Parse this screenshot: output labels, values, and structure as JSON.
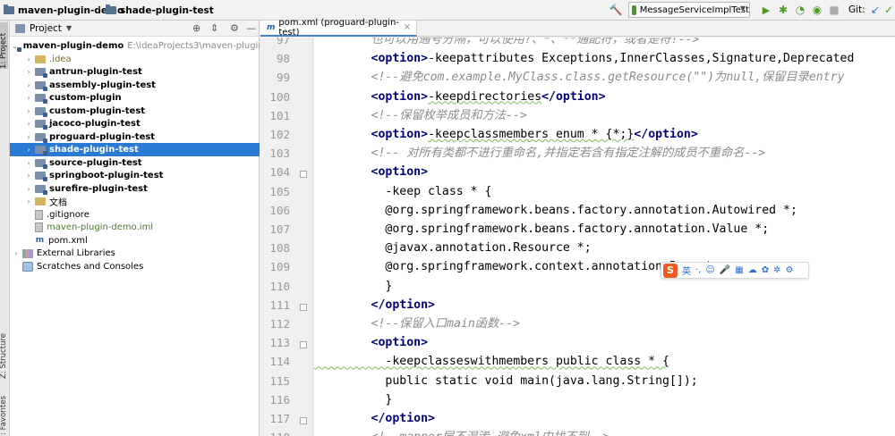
{
  "topbar": {
    "breadcrumb_root": "maven-plugin-demo",
    "breadcrumb_child": "shade-plugin-test",
    "run_config": "MessageServiceImplTest",
    "git_label": "Git:"
  },
  "sidebar_tabs": {
    "project": "1: Project",
    "structure": "Z: Structure",
    "favorites": "2: Favorites"
  },
  "project_panel": {
    "title": "Project",
    "tree": [
      {
        "label": "maven-plugin-demo",
        "path": "E:\\ideaProjects3\\maven-plugin-demo",
        "kind": "module-root",
        "expanded": true
      },
      {
        "label": ".idea",
        "kind": "folder-plain",
        "expanded": false
      },
      {
        "label": "antrun-plugin-test",
        "kind": "module",
        "expanded": false
      },
      {
        "label": "assembly-plugin-test",
        "kind": "module",
        "expanded": false
      },
      {
        "label": "custom-plugin",
        "kind": "module",
        "expanded": false
      },
      {
        "label": "custom-plugin-test",
        "kind": "module",
        "expanded": false
      },
      {
        "label": "jacoco-plugin-test",
        "kind": "module",
        "expanded": false
      },
      {
        "label": "proguard-plugin-test",
        "kind": "module",
        "expanded": false
      },
      {
        "label": "shade-plugin-test",
        "kind": "module",
        "expanded": false,
        "selected": true
      },
      {
        "label": "source-plugin-test",
        "kind": "module",
        "expanded": false
      },
      {
        "label": "springboot-plugin-test",
        "kind": "module",
        "expanded": false
      },
      {
        "label": "surefire-plugin-test",
        "kind": "module",
        "expanded": false
      },
      {
        "label": "文档",
        "kind": "folder-plain",
        "expanded": false
      },
      {
        "label": ".gitignore",
        "kind": "file"
      },
      {
        "label": "maven-plugin-demo.iml",
        "kind": "file-iml"
      },
      {
        "label": "pom.xml",
        "kind": "file-pom"
      },
      {
        "label": "External Libraries",
        "kind": "libraries",
        "expanded": false
      },
      {
        "label": "Scratches and Consoles",
        "kind": "scratches"
      }
    ]
  },
  "editor": {
    "tab_label": "pom.xml (proguard-plugin-test)",
    "lines": [
      {
        "n": "97",
        "partial": true,
        "segments": [
          {
            "t": "        也可以用通号分隔，可以使用?、*、**通配符，或者是符!-->",
            "c": "cmt"
          }
        ]
      },
      {
        "n": "98",
        "segments": [
          {
            "t": "        ",
            "c": "txt"
          },
          {
            "t": "<option>",
            "c": "tag"
          },
          {
            "t": "-keepattributes Exceptions,InnerClasses,Signature,Deprecated",
            "c": "txt"
          }
        ]
      },
      {
        "n": "99",
        "segments": [
          {
            "t": "        ",
            "c": "txt"
          },
          {
            "t": "<!--避免com.example.MyClass.class.getResource(\"\")为null,保留目录entry",
            "c": "cmt"
          }
        ]
      },
      {
        "n": "100",
        "segments": [
          {
            "t": "        ",
            "c": "txt"
          },
          {
            "t": "<option>",
            "c": "tag"
          },
          {
            "t": "-keepdirectories",
            "c": "txt"
          },
          {
            "t": "</option>",
            "c": "tag"
          }
        ]
      },
      {
        "n": "101",
        "segments": [
          {
            "t": "        ",
            "c": "txt"
          },
          {
            "t": "<!--保留枚举成员和方法-->",
            "c": "cmt"
          }
        ]
      },
      {
        "n": "102",
        "segments": [
          {
            "t": "        ",
            "c": "txt"
          },
          {
            "t": "<option>",
            "c": "tag"
          },
          {
            "t": "-keepclassmembers enum * {*;}",
            "c": "txt"
          },
          {
            "t": "</option>",
            "c": "tag"
          }
        ]
      },
      {
        "n": "103",
        "segments": [
          {
            "t": "        ",
            "c": "txt"
          },
          {
            "t": "<!-- 对所有类都不进行重命名,并指定若含有指定注解的成员不重命名-->",
            "c": "cmt"
          }
        ]
      },
      {
        "n": "104",
        "segments": [
          {
            "t": "        ",
            "c": "txt"
          },
          {
            "t": "<option>",
            "c": "tag"
          }
        ]
      },
      {
        "n": "105",
        "segments": [
          {
            "t": "          -keep class * {",
            "c": "txt"
          }
        ]
      },
      {
        "n": "106",
        "segments": [
          {
            "t": "          @org.springframework.beans.factory.annotation.Autowired *;",
            "c": "txt"
          }
        ]
      },
      {
        "n": "107",
        "segments": [
          {
            "t": "          @org.springframework.beans.factory.annotation.Value *;",
            "c": "txt"
          }
        ]
      },
      {
        "n": "108",
        "segments": [
          {
            "t": "          @javax.annotation.Resource *;",
            "c": "txt"
          }
        ]
      },
      {
        "n": "109",
        "segments": [
          {
            "t": "          @org.springframework.context.annotation.Bean *;",
            "c": "txt"
          }
        ]
      },
      {
        "n": "110",
        "segments": [
          {
            "t": "          }",
            "c": "txt"
          }
        ]
      },
      {
        "n": "111",
        "segments": [
          {
            "t": "        ",
            "c": "txt"
          },
          {
            "t": "</option>",
            "c": "tag"
          }
        ]
      },
      {
        "n": "112",
        "segments": [
          {
            "t": "        ",
            "c": "txt"
          },
          {
            "t": "<!--保留入口main函数-->",
            "c": "cmt"
          }
        ]
      },
      {
        "n": "113",
        "segments": [
          {
            "t": "        ",
            "c": "txt"
          },
          {
            "t": "<option>",
            "c": "tag"
          }
        ]
      },
      {
        "n": "114",
        "segments": [
          {
            "t": "          -keepclasseswithmembers public class * {",
            "c": "txt"
          }
        ]
      },
      {
        "n": "115",
        "segments": [
          {
            "t": "          public static void main(java.lang.String[]);",
            "c": "txt"
          }
        ]
      },
      {
        "n": "116",
        "segments": [
          {
            "t": "          }",
            "c": "txt"
          }
        ]
      },
      {
        "n": "117",
        "segments": [
          {
            "t": "        ",
            "c": "txt"
          },
          {
            "t": "</option>",
            "c": "tag"
          }
        ]
      },
      {
        "n": "118",
        "segments": [
          {
            "t": "        ",
            "c": "txt"
          },
          {
            "t": "<!--mapper层不混淆,避免xml中找不到-->",
            "c": "cmt"
          }
        ]
      }
    ]
  },
  "ime_toolbar": {
    "logo": "S",
    "items": [
      "英",
      "·,",
      "☺",
      "🎤",
      "▦",
      "☁",
      "✿",
      "✲",
      "⚙"
    ]
  },
  "colors": {
    "selection": "#2a79d2",
    "tag": "#000080",
    "comment": "#8c8c8c",
    "run_green": "#4e9a2a"
  }
}
